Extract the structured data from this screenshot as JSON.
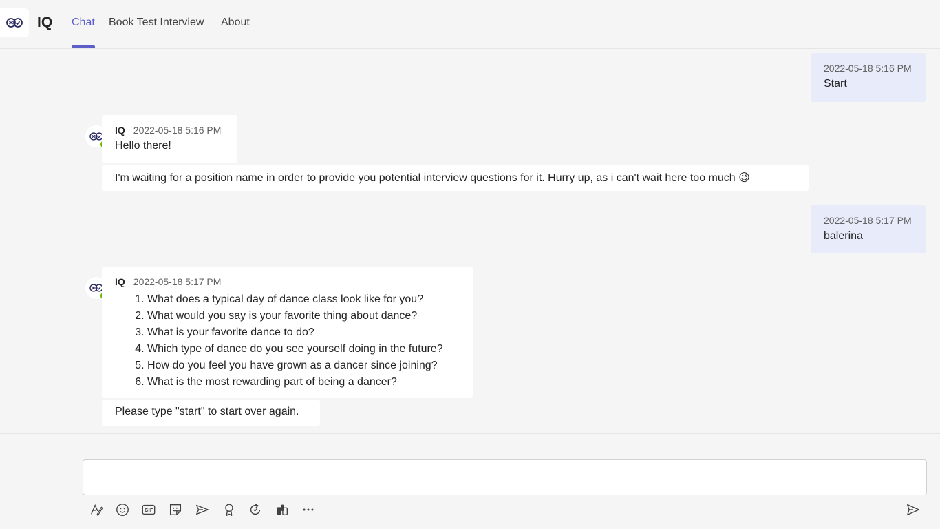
{
  "app": {
    "title": "IQ",
    "icon": "owl-bot-icon"
  },
  "tabs": [
    {
      "label": "Chat",
      "active": true
    },
    {
      "label": "Book Test Interview",
      "active": false
    },
    {
      "label": "About",
      "active": false
    }
  ],
  "messages": [
    {
      "from": "me",
      "time": "2022-05-18 5:16 PM",
      "text": "Start"
    },
    {
      "from": "bot",
      "sender": "IQ",
      "time": "2022-05-18 5:16 PM",
      "text": "Hello there!",
      "followup": "I'm waiting for a position name in order to provide you potential interview questions for it. Hurry up, as i can't wait here too much 😉"
    },
    {
      "from": "me",
      "time": "2022-05-18 5:17 PM",
      "text": "balerina"
    },
    {
      "from": "bot",
      "sender": "IQ",
      "time": "2022-05-18 5:17 PM",
      "list": [
        "What does a typical day of dance class look like for you?",
        "What would you say is your favorite thing about dance?",
        "What is your favorite dance to do?",
        "Which type of dance do you see yourself doing in the future?",
        "How do you feel you have grown as a dancer since joining?",
        "What is the most rewarding part of being a dancer?"
      ],
      "followup": "Please type \"start\" to start over again."
    }
  ],
  "compose": {
    "value": "",
    "placeholder": ""
  },
  "toolbar": [
    "format-icon",
    "emoji-icon",
    "gif-icon",
    "sticker-icon",
    "meet-now-icon",
    "praise-icon",
    "loop-icon",
    "apps-icon",
    "more-options-icon",
    "send-icon"
  ],
  "colors": {
    "accent": "#5b5fc7",
    "my_bubble": "#e8ebfa",
    "presence": "#6bb700"
  }
}
